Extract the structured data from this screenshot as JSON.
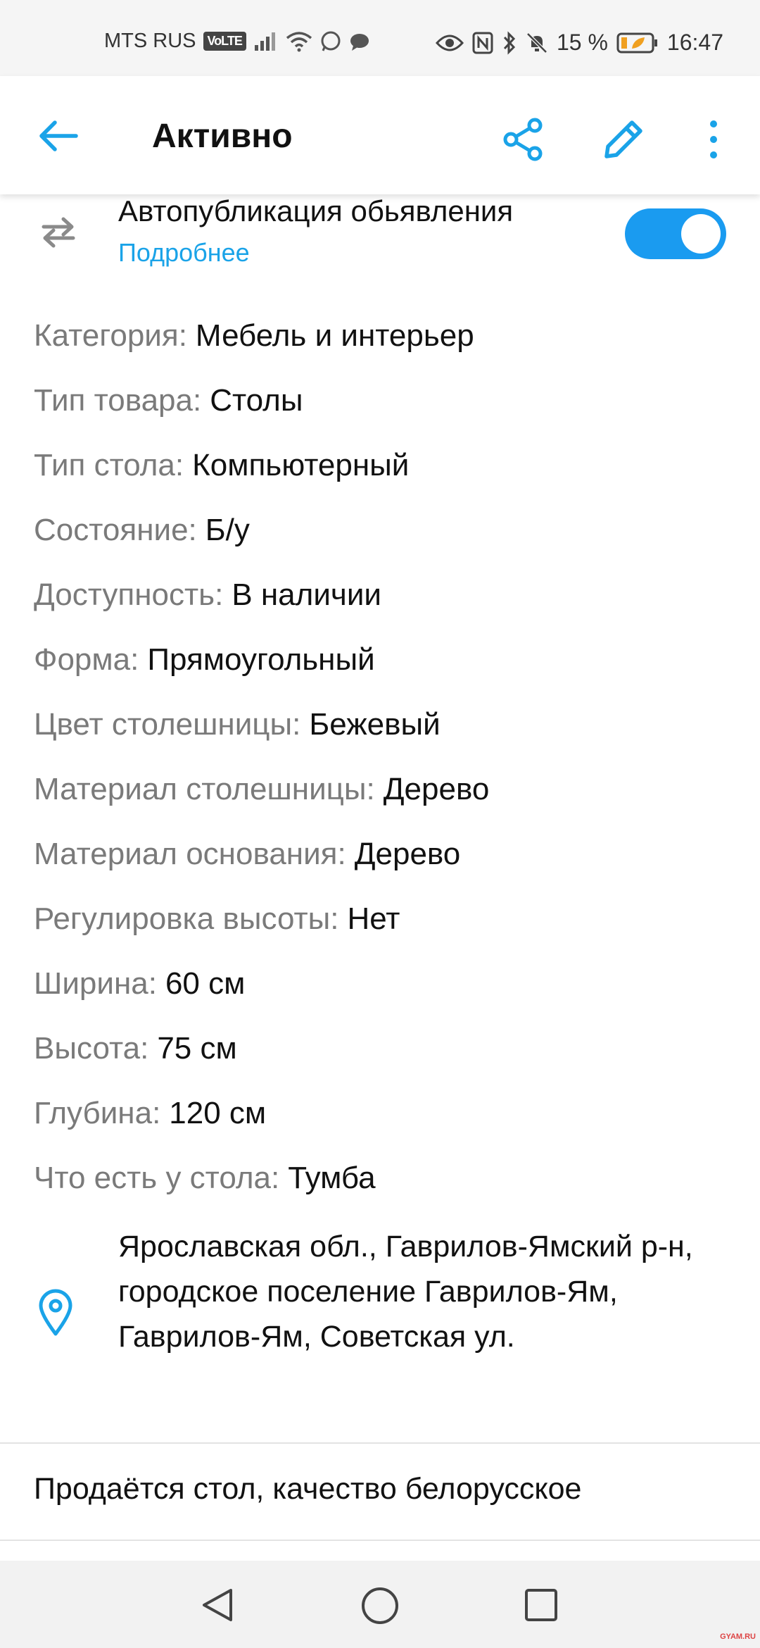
{
  "status_bar": {
    "carrier": "MTS RUS",
    "volte": "VoLTE",
    "battery": "15 %",
    "time": "16:47"
  },
  "app_bar": {
    "title": "Активно",
    "back_icon": "arrow-left-icon",
    "share_icon": "share-icon",
    "edit_icon": "pencil-icon",
    "more_icon": "more-vertical-icon"
  },
  "auto_publish": {
    "title": "Автопубликация обьявления",
    "link": "Подробнее",
    "enabled": true,
    "icon": "repeat-icon"
  },
  "properties": [
    {
      "label": "Категория:",
      "value": "Мебель и интерьер"
    },
    {
      "label": "Тип товара:",
      "value": "Столы"
    },
    {
      "label": "Тип стола:",
      "value": "Компьютерный"
    },
    {
      "label": "Состояние:",
      "value": "Б/у"
    },
    {
      "label": "Доступность:",
      "value": "В наличии"
    },
    {
      "label": "Форма:",
      "value": "Прямоугольный"
    },
    {
      "label": "Цвет столешницы:",
      "value": "Бежевый"
    },
    {
      "label": "Материал столешницы:",
      "value": "Дерево"
    },
    {
      "label": "Материал основания:",
      "value": "Дерево"
    },
    {
      "label": "Регулировка высоты:",
      "value": "Нет"
    },
    {
      "label": "Ширина:",
      "value": "60 см"
    },
    {
      "label": "Высота:",
      "value": "75 см"
    },
    {
      "label": "Глубина:",
      "value": "120 см"
    },
    {
      "label": "Что есть у стола:",
      "value": "Тумба"
    }
  ],
  "location": {
    "icon": "map-pin-icon",
    "address": "Ярославская обл., Гаврилов-Ямский р-н, городское поселение Гаврилов-Ям, Гаврилов-Ям, Советская ул."
  },
  "description": "Продаётся стол, качество белорусское",
  "colors": {
    "accent": "#1aa3e8",
    "toggle": "#1a9bf0",
    "label_gray": "#7a7a7a"
  },
  "watermark": "GYAM.RU"
}
